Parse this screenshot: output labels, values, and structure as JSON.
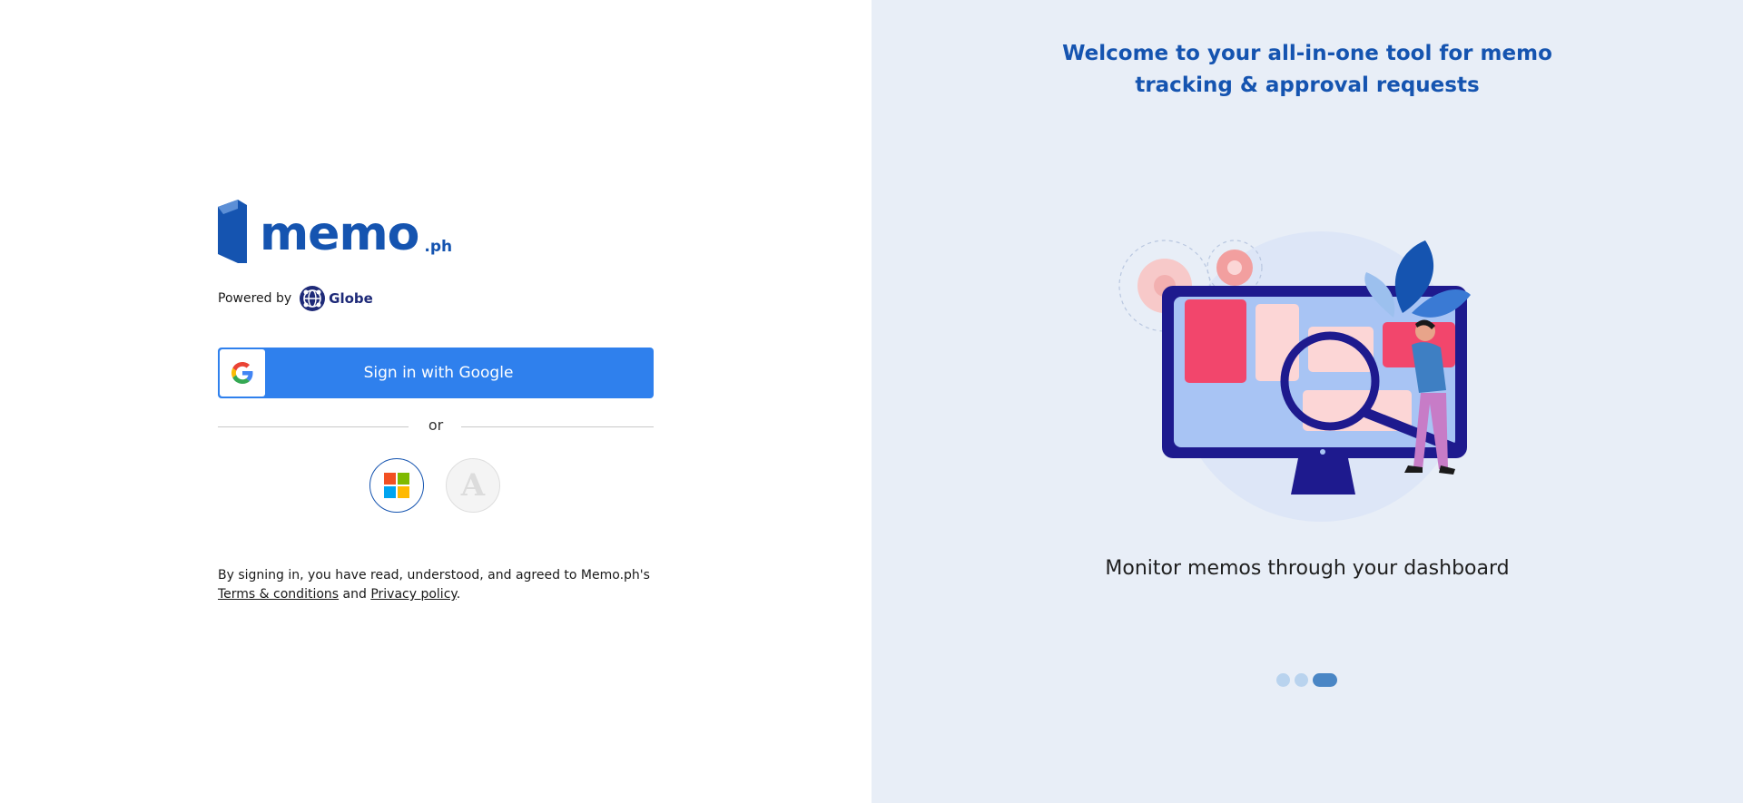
{
  "brand": {
    "logo_text": "memo",
    "logo_suffix": ".ph",
    "powered_by_label": "Powered by",
    "partner_name": "Globe",
    "primary_color": "#1554b0"
  },
  "auth": {
    "google_button_label": "Sign in with Google",
    "google_button_color": "#2f80ed",
    "divider_text": "or",
    "alt_providers": [
      {
        "name": "microsoft",
        "icon": "microsoft-icon"
      },
      {
        "name": "a",
        "letter": "A"
      }
    ]
  },
  "terms": {
    "prefix": "By signing in, you have read, understood, and agreed to Memo.ph's",
    "terms_link": "Terms & conditions",
    "conjunction": "and",
    "privacy_link": "Privacy policy",
    "suffix": "."
  },
  "carousel": {
    "headline": "Welcome to your all-in-one tool for memo tracking & approval requests",
    "slide_caption": "Monitor memos through your dashboard",
    "slide_count": 3,
    "active_index": 2
  }
}
